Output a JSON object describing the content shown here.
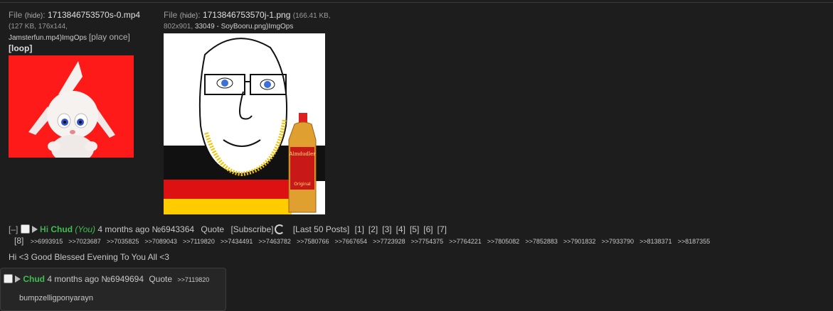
{
  "file1": {
    "prefix": "File",
    "hide": "(hide)",
    "colon": ":",
    "filename": "1713846753570s-0.mp4",
    "meta": "(127 KB, 176x144,",
    "orig": "Jamsterfun.mp4)",
    "imgops": "ImgOps",
    "play": "[play once]",
    "loop": "[loop]"
  },
  "file2": {
    "prefix": "File",
    "hide": "(hide)",
    "colon": ":",
    "filename": "1713846753570j-1.png",
    "meta": "(166.41 KB,",
    "meta2": "802x901,",
    "meta3": "33049 - SoyBooru.png)",
    "imgops": "ImgOps"
  },
  "op": {
    "collapse": "[–]",
    "subject": "Hi",
    "name": "Chud",
    "you": "(You)",
    "date": "4 months ago",
    "postno": "№6943364",
    "quote": "Quote",
    "subscribe": "[Subscribe]",
    "last50": "[Last 50 Posts]",
    "pages": [
      "[1]",
      "[2]",
      "[3]",
      "[4]",
      "[5]",
      "[6]",
      "[7]"
    ],
    "page8": "[8]",
    "replies": [
      ">>6993915",
      ">>7023687",
      ">>7035825",
      ">>7089043",
      ">>7119820",
      ">>7434491",
      ">>7463782",
      ">>7580766",
      ">>7667654",
      ">>7723928",
      ">>7754375",
      ">>7764221",
      ">>7805082",
      ">>7852883",
      ">>7901832",
      ">>7933790",
      ">>8138371",
      ">>8187355"
    ],
    "message": "Hi <3 Good Blessed Evening To You All <3"
  },
  "reply": {
    "name": "Chud",
    "date": "4 months ago",
    "postno": "№6949694",
    "quote": "Quote",
    "backlink": ">>7119820",
    "message": "bumpzelligponyarayn"
  },
  "bottle_label": {
    "brand": "Almdudler",
    "variant": "Original"
  },
  "colors": {
    "name_green": "#3fbf4f",
    "video_bg": "#ff1a1a"
  }
}
